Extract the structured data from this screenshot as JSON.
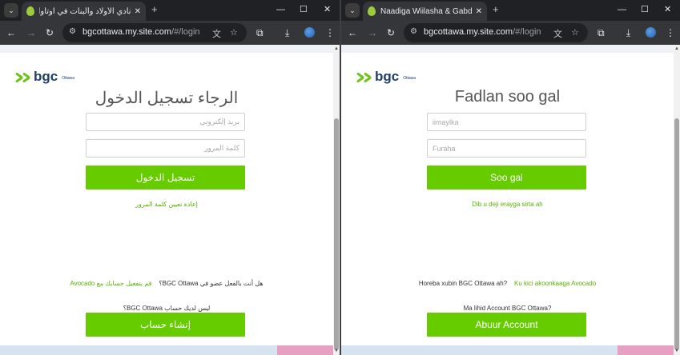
{
  "left": {
    "tab": {
      "title": "نادي الأولاد والبنات في أوتاوا"
    },
    "omnibox": {
      "host": "bgcottawa.my.site.com",
      "path": "/#/login"
    },
    "logo": {
      "word": "bgc",
      "city": "Ottawa"
    },
    "heading": "الرجاء تسجيل الدخول",
    "email_placeholder": "بريد إلكتروني",
    "password_placeholder": "كلمة المرور",
    "login_button": "تسجيل الدخول",
    "reset_link": "إعادة تعيين كلمة المرور",
    "member_question": "هل أنت بالفعل عضو في BGC Ottawa؟",
    "activate_link": "قم بتفعيل حسابك مع Avocado",
    "no_account": "ليس لديك حساب BGC Ottawa؟",
    "create_button": "إنشاء حساب"
  },
  "right": {
    "tab": {
      "title": "Naadiga Wiilasha & Gabdhaha"
    },
    "omnibox": {
      "host": "bgcottawa.my.site.com",
      "path": "/#/login"
    },
    "logo": {
      "word": "bgc",
      "city": "Ottawa"
    },
    "heading": "Fadlan soo gal",
    "email_placeholder": "iimayl­ka",
    "password_placeholder": "Furaha",
    "login_button": "Soo gal",
    "reset_link": "Dib u deji erayga sirta ah",
    "member_question": "Horeba xubin BGC Ottawa ah?",
    "activate_link": "Ku kici akoonkaaga Avocado",
    "no_account": "Ma lihid Account BGC Ottawa?",
    "create_button": "Abuur Account"
  },
  "icons": {
    "tab_search": "chevron-down-icon",
    "favicon": "avocado-icon",
    "close": "close-icon",
    "new_tab": "plus-icon",
    "back": "back-arrow-icon",
    "forward": "forward-arrow-icon",
    "reload": "reload-icon",
    "site_info": "tune-icon",
    "translate": "translate-icon",
    "bookmark": "star-icon",
    "extensions": "puzzle-icon",
    "download": "download-icon",
    "menu": "kebab-menu-icon"
  },
  "colors": {
    "accent_green": "#66cc00",
    "link_green": "#59b100",
    "brand_blue": "#1f3e70"
  }
}
